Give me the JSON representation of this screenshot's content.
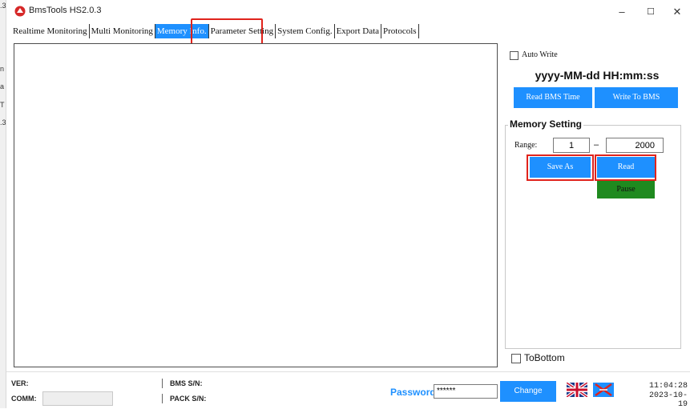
{
  "window": {
    "title": "BmsTools HS2.0.3",
    "minimize_glyph": "–",
    "maximize_glyph": "☐",
    "close_glyph": "✕"
  },
  "edge_fragments": [
    ".3",
    "n",
    "a",
    "T",
    ".3"
  ],
  "tabs": [
    {
      "label": "Realtime Monitoring",
      "selected": false
    },
    {
      "label": "Multi Monitoring",
      "selected": false
    },
    {
      "label": "Memory Info.",
      "selected": true
    },
    {
      "label": "Parameter Setting",
      "selected": false
    },
    {
      "label": "System Config.",
      "selected": false
    },
    {
      "label": "Export Data",
      "selected": false
    },
    {
      "label": "Protocols",
      "selected": false
    }
  ],
  "time_panel": {
    "auto_write_label": "Auto Write",
    "datetime_format": "yyyy-MM-dd HH:mm:ss",
    "read_bms_time": "Read BMS Time",
    "write_to_bms": "Write To BMS"
  },
  "memory_setting": {
    "group_title": "Memory Setting",
    "range_label": "Range:",
    "range_from": "1",
    "range_separator": "–",
    "range_to": "2000",
    "save_as": "Save As",
    "read": "Read",
    "pause": "Pause"
  },
  "to_bottom_label": "ToBottom",
  "status": {
    "ver_label": "VER:",
    "comm_label": "COMM:",
    "comm_value": "",
    "bms_sn_label": "BMS S/N:",
    "pack_sn_label": "PACK S/N:",
    "password_label": "Password",
    "password_value": "******",
    "change_button": "Change",
    "time": "11:04:28",
    "date": "2023-10-19"
  },
  "colors": {
    "accent_blue": "#1e90ff",
    "pause_green": "#1f8a1f",
    "highlight_red": "#e0231c"
  },
  "icons": {
    "app": "bms-logo-icon",
    "language_en": "uk-flag-icon",
    "language_cn": "cn-flag-icon"
  }
}
